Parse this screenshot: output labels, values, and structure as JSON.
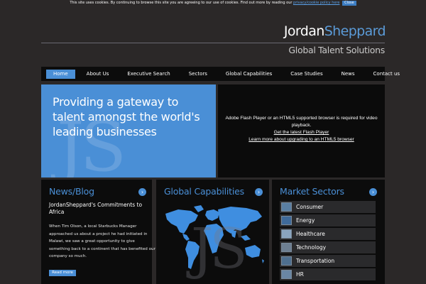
{
  "cookie_bar": {
    "text": "This site uses cookies. By continuing to browse this site you are agreeing to our use of cookies. Find out more by reading our",
    "link": "privacy/cookie policy here",
    "close": "Close"
  },
  "logo": {
    "first": "Jordan",
    "last": "Sheppard"
  },
  "tagline": "Global Talent Solutions",
  "nav": [
    "Home",
    "About Us",
    "Executive Search",
    "Sectors",
    "Global Capabilities",
    "Case Studies",
    "News",
    "Contact us"
  ],
  "hero": {
    "heading": "Providing a gateway to talent amongst the world's leading businesses",
    "watermark": "JS"
  },
  "flash": {
    "message": "Adobe Flash Player or an HTML5 supported browser is required for video playback.",
    "link1": "Get the latest Flash Player",
    "link2": "Learn more about upgrading to an HTML5 browser"
  },
  "news": {
    "title": "News/Blog",
    "headline": "JordanSheppard's Commitments to Africa",
    "body": "When Tim Olson, a local Starbucks Manager approached us about a project he had initiated in Malawi, we saw a great opportunity to give something back to a continent that has benefited our company so much.",
    "read_more": "Read more"
  },
  "capabilities": {
    "title": "Global Capabilities",
    "watermark": "JS"
  },
  "sectors": {
    "title": "Market Sectors",
    "items": [
      {
        "label": "Consumer",
        "thumb": "#5a7fa3"
      },
      {
        "label": "Energy",
        "thumb": "#3f6a9a"
      },
      {
        "label": "Healthcare",
        "thumb": "#8aa4bf"
      },
      {
        "label": "Technology",
        "thumb": "#6d7f92"
      },
      {
        "label": "Transportation",
        "thumb": "#4e6f8f"
      },
      {
        "label": "HR",
        "thumb": "#6a86a4"
      }
    ]
  },
  "colors": {
    "accent": "#4a8fd6",
    "background": "#2b2828",
    "panel": "#0c0c0c"
  }
}
